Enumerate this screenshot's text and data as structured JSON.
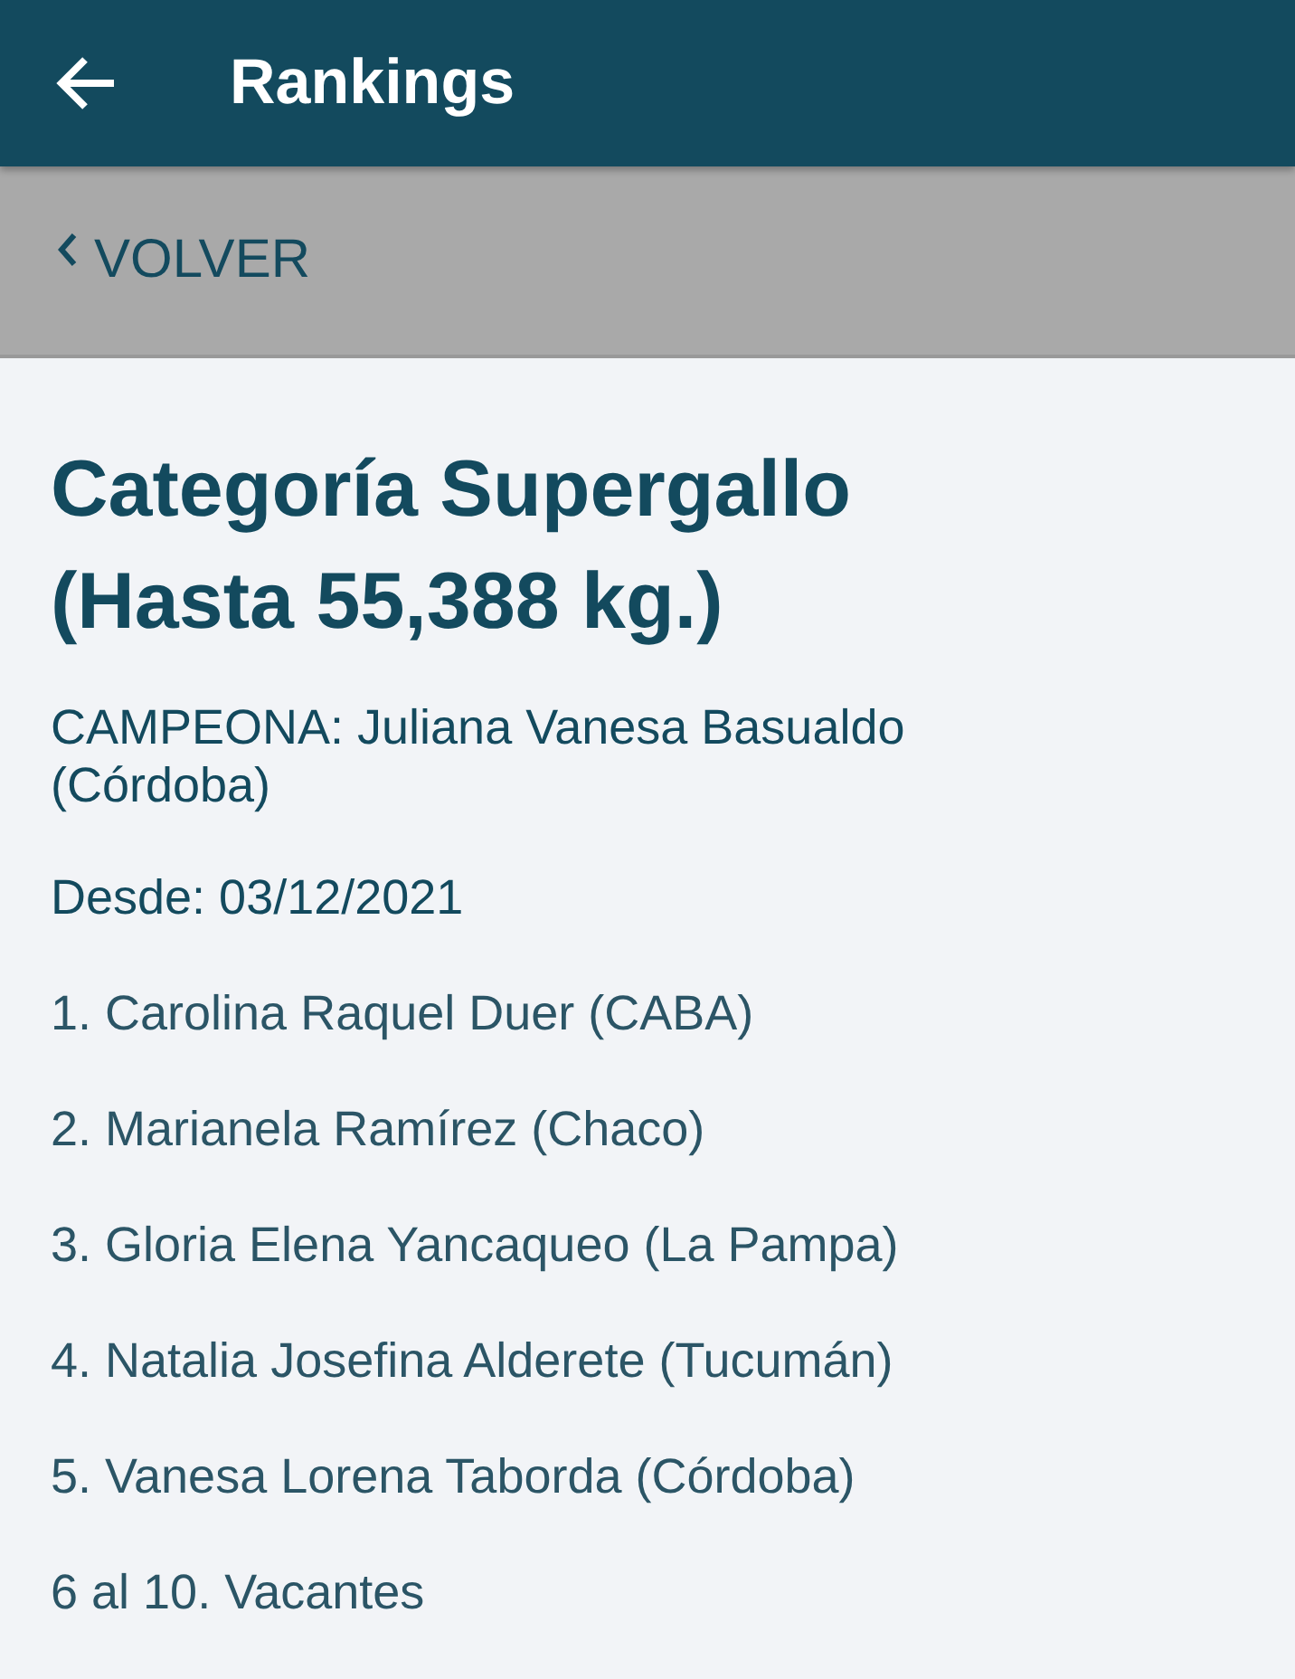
{
  "app_bar": {
    "title": "Rankings"
  },
  "back_link": {
    "label": "VOLVER"
  },
  "category": {
    "title": "Categoría Supergallo (Hasta 55,388 kg.)",
    "champion": "CAMPEONA: Juliana Vanesa Basualdo (Córdoba)",
    "since": "Desde: 03/12/2021"
  },
  "ranking": [
    "1. Carolina Raquel Duer (CABA)",
    "2. Marianela Ramírez (Chaco)",
    "3. Gloria Elena Yancaqueo (La Pampa)",
    "4. Natalia Josefina Alderete (Tucumán)",
    "5. Vanesa Lorena Taborda (Córdoba)",
    "6 al 10. Vacantes"
  ]
}
